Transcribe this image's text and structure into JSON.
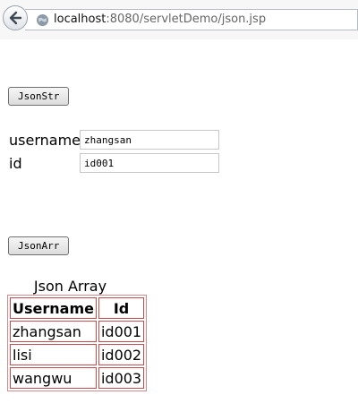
{
  "browser": {
    "url_host": "localhost",
    "url_path": ":8080/servletDemo/json.jsp"
  },
  "page": {
    "json_str_button": "JsonStr",
    "username_label": "username",
    "username_value": "zhangsan",
    "id_label": "id",
    "id_value": "id001",
    "json_arr_button": "JsonArr",
    "table_caption": "Json Array",
    "table": {
      "headers": [
        "Username",
        "Id"
      ],
      "rows": [
        [
          "zhangsan",
          "id001"
        ],
        [
          "lisi",
          "id002"
        ],
        [
          "wangwu",
          "id003"
        ]
      ]
    }
  }
}
